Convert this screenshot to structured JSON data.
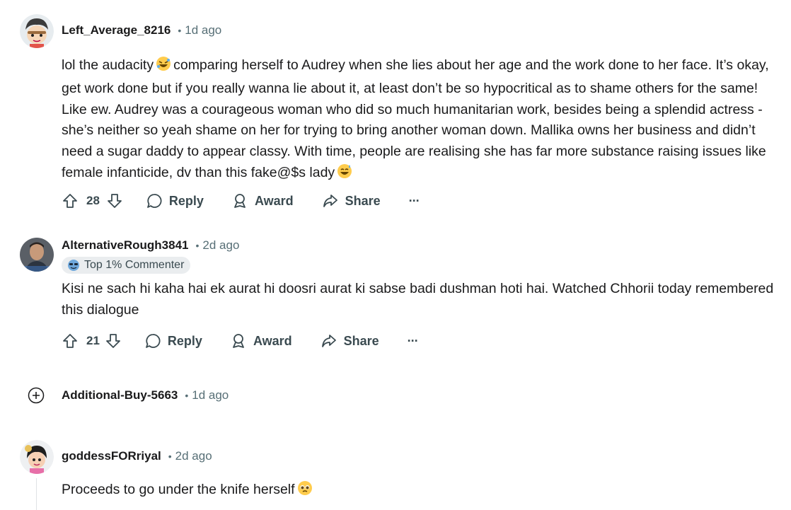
{
  "comments": [
    {
      "username": "Left_Average_8216",
      "age": "1d ago",
      "text_parts": [
        "lol the audacity",
        "comparing herself to Audrey when she lies about her age and the work done to her face. It’s okay, get work done but if you really wanna lie about it, at least don’t be so hypocritical as to shame others for the same! Like ew. Audrey was a courageous woman who did so much humanitarian work, besides being a splendid actress - she’s neither so yeah shame on her for trying to bring another woman down. Mallika owns her business and didn’t need a sugar daddy to appear classy. With time, people are realising she has far more substance raising issues like female infanticide, dv than this fake@$s lady"
      ],
      "emojis": [
        "rolling-on-floor-laughing-emoji",
        "smiling-face-with-sweat-emoji"
      ],
      "votes": "28",
      "reply_label": "Reply",
      "award_label": "Award",
      "share_label": "Share",
      "more_label": "···"
    },
    {
      "username": "AlternativeRough3841",
      "age": "2d ago",
      "badge": "Top 1% Commenter",
      "text": "Kisi ne sach hi kaha hai ek aurat hi doosri aurat ki sabse badi dushman hoti hai. Watched Chhorii today remembered this dialogue",
      "votes": "21",
      "reply_label": "Reply",
      "award_label": "Award",
      "share_label": "Share",
      "more_label": "···"
    },
    {
      "username": "Additional-Buy-5663",
      "age": "1d ago",
      "collapsed": true
    },
    {
      "username": "goddessFORriyal",
      "age": "2d ago",
      "text": "Proceeds to go under the knife herself",
      "emojis": [
        "pleading-face-emoji"
      ]
    }
  ],
  "separator": "•",
  "colors": {
    "text": "#1a1a1b",
    "meta": "#576f76",
    "action": "#3a4a50",
    "badge_bg": "#eaedef",
    "rail": "#dfe3e5"
  }
}
